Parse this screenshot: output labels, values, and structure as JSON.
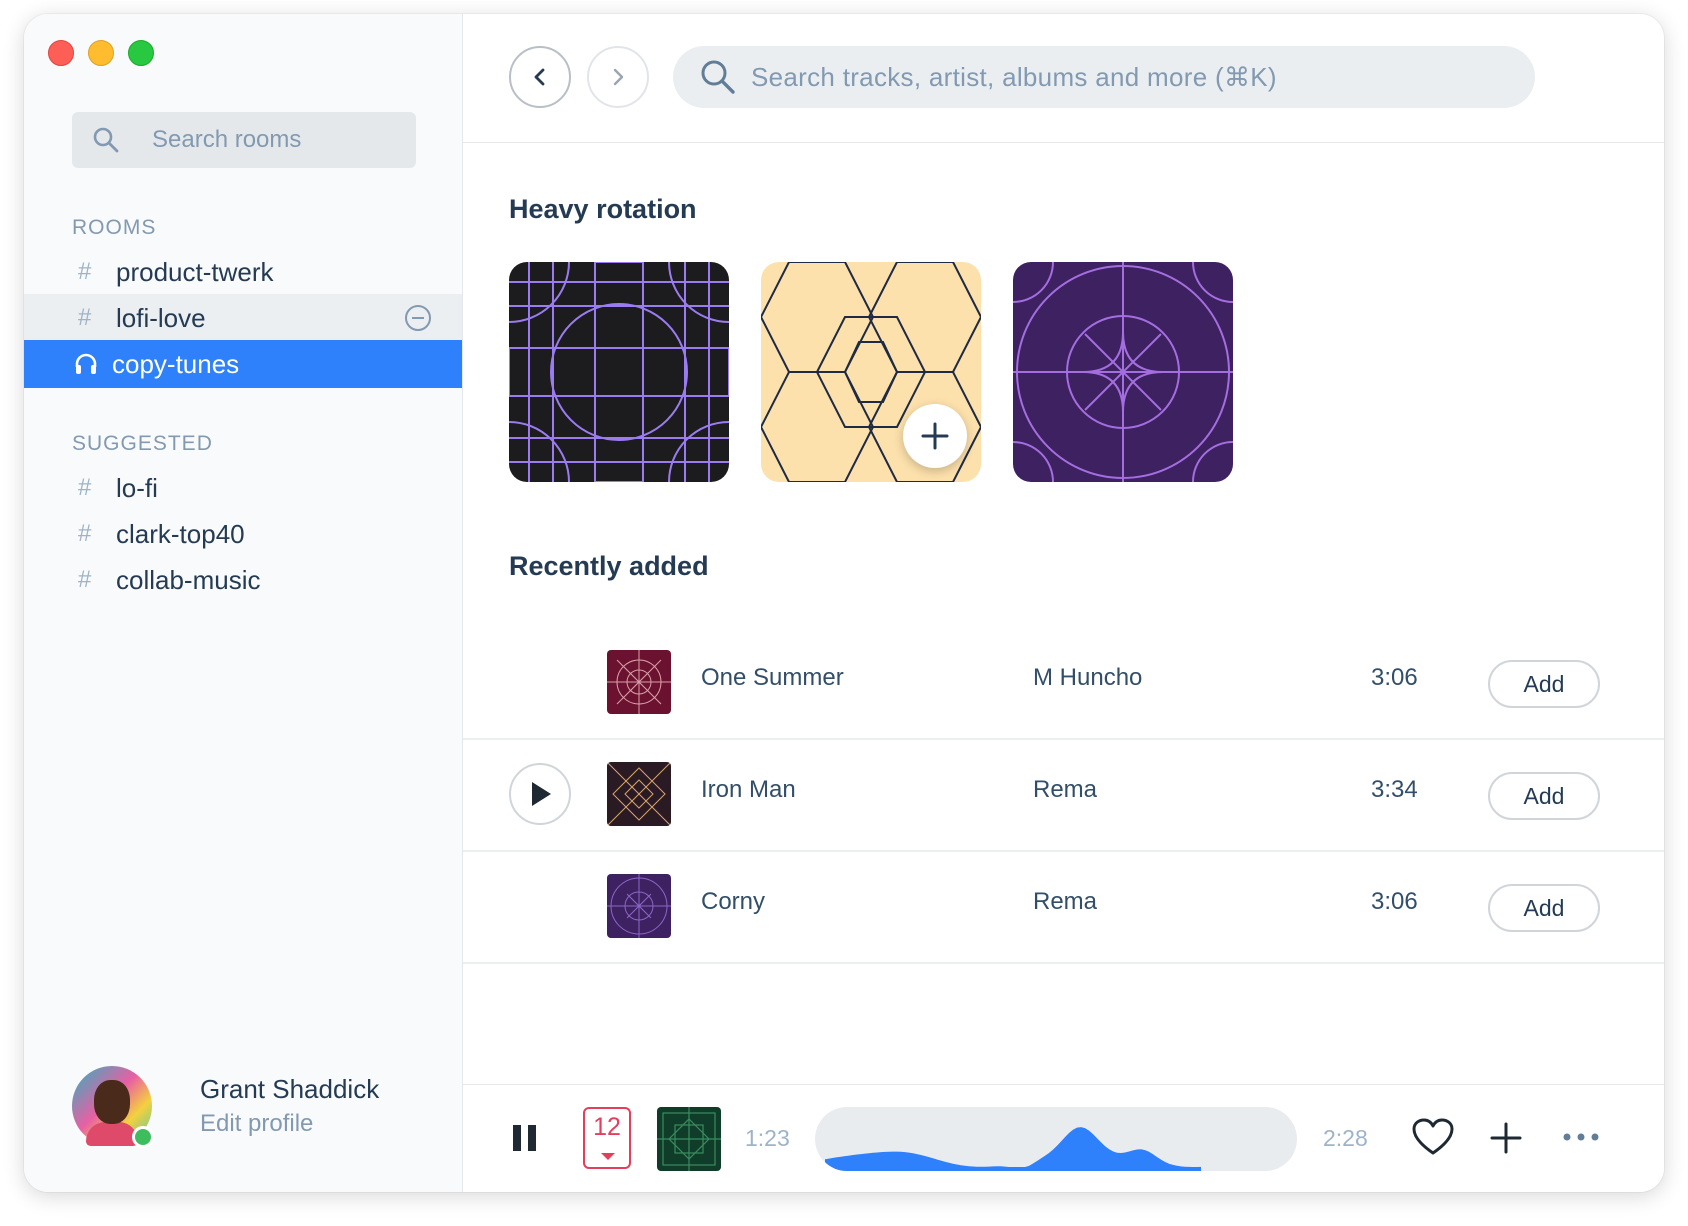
{
  "sidebar": {
    "search_placeholder": "Search rooms",
    "rooms_label": "ROOMS",
    "rooms": [
      {
        "name": "product-twerk",
        "icon": "hash"
      },
      {
        "name": "lofi-love",
        "icon": "hash"
      },
      {
        "name": "copy-tunes",
        "icon": "headphones-icon"
      }
    ],
    "suggested_label": "SUGGESTED",
    "suggested": [
      {
        "name": "lo-fi",
        "icon": "hash"
      },
      {
        "name": "clark-top40",
        "icon": "hash"
      },
      {
        "name": "collab-music",
        "icon": "hash"
      }
    ],
    "hash_symbol": "#",
    "profile": {
      "name": "Grant Shaddick",
      "edit_label": "Edit profile",
      "status": "online"
    }
  },
  "header": {
    "search_placeholder": "Search tracks, artist, albums and more (⌘K)"
  },
  "heavy_rotation": {
    "title": "Heavy rotation",
    "albums": [
      {
        "name": "album-dark-grid",
        "bg": "#1c1c1e",
        "line": "#9b7bf0"
      },
      {
        "name": "album-hexagon",
        "bg": "#fde1ac",
        "line": "#1f2a44"
      },
      {
        "name": "album-purple-circle",
        "bg": "#3d2160",
        "line": "#a46de0"
      }
    ]
  },
  "recently_added": {
    "title": "Recently added",
    "tracks": [
      {
        "title": "One Summer",
        "artist": "M Huncho",
        "duration": "3:06",
        "add_label": "Add",
        "art_bg": "#6b1230",
        "art_line": "#d9a0a8"
      },
      {
        "title": "Iron Man",
        "artist": "Rema",
        "duration": "3:34",
        "add_label": "Add",
        "art_bg": "#2a1a24",
        "art_line": "#d8a46a"
      },
      {
        "title": "Corny",
        "artist": "Rema",
        "duration": "3:06",
        "add_label": "Add",
        "art_bg": "#3d2160",
        "art_line": "#8c66c8"
      }
    ]
  },
  "player": {
    "calendar_number": "12",
    "current_time": "1:23",
    "total_time": "2:28",
    "progress": 0.8,
    "art_bg": "#0f3d2a",
    "art_line": "#3c8c60",
    "accent": "#2f80fb"
  },
  "colors": {
    "accent": "#2f80fb",
    "danger": "#e53e5b",
    "online": "#3ebd5f"
  }
}
